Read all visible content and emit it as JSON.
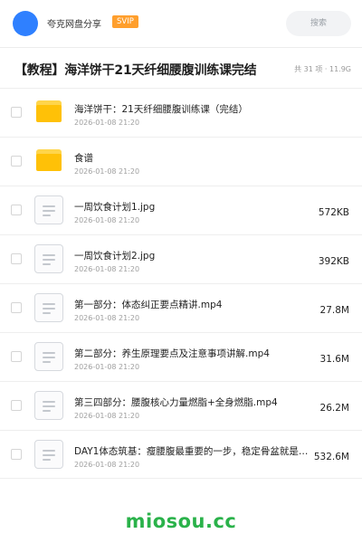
{
  "header": {
    "username": "夸克网盘分享",
    "badge": "SVIP",
    "search_placeholder": "搜索"
  },
  "folder": {
    "title": "【教程】海洋饼干21天纤细腰腹训练课完结",
    "meta": "共 31 项 · 11.9G"
  },
  "files": [
    {
      "type": "folder",
      "icon": "folder-icon",
      "name": "海洋饼干：21天纤细腰腹训练课（完结）",
      "date": "2026-01-08 21:20",
      "size": ""
    },
    {
      "type": "folder",
      "icon": "folder-icon",
      "name": "食谱",
      "date": "2026-01-08 21:20",
      "size": ""
    },
    {
      "type": "file",
      "icon": "document-icon",
      "name": "一周饮食计划1.jpg",
      "date": "2026-01-08 21:20",
      "size": "572KB"
    },
    {
      "type": "file",
      "icon": "document-icon",
      "name": "一周饮食计划2.jpg",
      "date": "2026-01-08 21:20",
      "size": "392KB"
    },
    {
      "type": "file",
      "icon": "document-icon",
      "name": "第一部分：体态纠正要点精讲.mp4",
      "date": "2026-01-08 21:20",
      "size": "27.8M"
    },
    {
      "type": "file",
      "icon": "document-icon",
      "name": "第二部分：养生原理要点及注意事项讲解.mp4",
      "date": "2026-01-08 21:20",
      "size": "31.6M"
    },
    {
      "type": "file",
      "icon": "document-icon",
      "name": "第三四部分：腰腹核心力量燃脂+全身燃脂.mp4",
      "date": "2026-01-08 21:20",
      "size": "26.2M"
    },
    {
      "type": "file",
      "icon": "document-icon",
      "name": "DAY1体态筑基：瘦腰腹最重要的一步，稳定骨盆就是…",
      "date": "2026-01-08 21:20",
      "size": "532.6M"
    }
  ],
  "watermark": "miosou.cc",
  "colors": {
    "avatar": "#2f80ff",
    "badge": "#ff9f2d",
    "folder": "#ffc107",
    "watermark": "#2ab24a"
  }
}
